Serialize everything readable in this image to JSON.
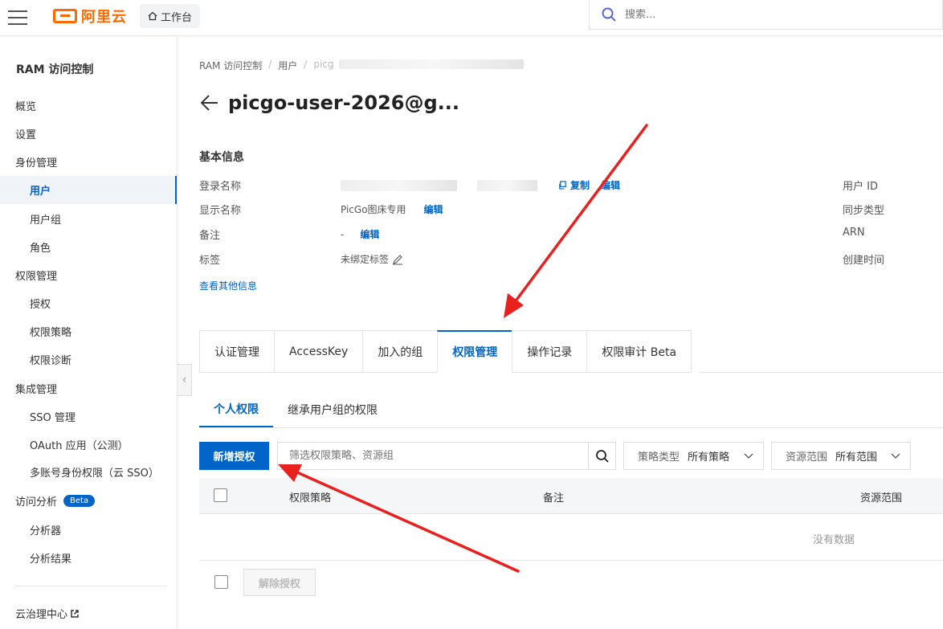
{
  "header": {
    "brand": "阿里云",
    "workbench": "工作台",
    "search_placeholder": "搜索..."
  },
  "sidebar": {
    "title": "RAM 访问控制",
    "items": [
      {
        "label": "概览",
        "level": 1
      },
      {
        "label": "设置",
        "level": 1
      },
      {
        "label": "身份管理",
        "level": 1
      },
      {
        "label": "用户",
        "level": 2,
        "active": true
      },
      {
        "label": "用户组",
        "level": 2
      },
      {
        "label": "角色",
        "level": 2
      },
      {
        "label": "权限管理",
        "level": 1
      },
      {
        "label": "授权",
        "level": 2
      },
      {
        "label": "权限策略",
        "level": 2
      },
      {
        "label": "权限诊断",
        "level": 2
      },
      {
        "label": "集成管理",
        "level": 1
      },
      {
        "label": "SSO 管理",
        "level": 2
      },
      {
        "label": "OAuth 应用（公测）",
        "level": 2
      },
      {
        "label": "多账号身份权限（云 SSO）",
        "level": 2
      },
      {
        "label": "访问分析",
        "level": 1,
        "badge": "Beta"
      },
      {
        "label": "分析器",
        "level": 2
      },
      {
        "label": "分析结果",
        "level": 2
      }
    ],
    "footer": "云治理中心"
  },
  "breadcrumb": [
    "RAM 访问控制",
    "用户",
    "picg"
  ],
  "page": {
    "title": "picgo-user-2026@g..."
  },
  "basic_info": {
    "title": "基本信息",
    "rows": [
      {
        "label": "登录名称",
        "value": "",
        "actions": [
          "复制",
          "编辑"
        ]
      },
      {
        "label": "显示名称",
        "value": "PicGo图床专用",
        "actions": [
          "编辑"
        ]
      },
      {
        "label": "备注",
        "value": "-",
        "actions": [
          "编辑"
        ]
      },
      {
        "label": "标签",
        "value": "未绑定标签",
        "actions": []
      }
    ],
    "right_labels": [
      "用户 ID",
      "同步类型",
      "ARN",
      "创建时间"
    ],
    "more_link": "查看其他信息"
  },
  "tabs": [
    {
      "label": "认证管理"
    },
    {
      "label": "AccessKey"
    },
    {
      "label": "加入的组"
    },
    {
      "label": "权限管理",
      "active": true
    },
    {
      "label": "操作记录"
    },
    {
      "label": "权限审计 Beta"
    }
  ],
  "subtabs": [
    {
      "label": "个人权限",
      "active": true
    },
    {
      "label": "继承用户组的权限"
    }
  ],
  "toolbar": {
    "add_button": "新增授权",
    "filter_placeholder": "筛选权限策略、资源组",
    "policy_type_label": "策略类型",
    "policy_type_value": "所有策略",
    "scope_label": "资源范围",
    "scope_value": "所有范围"
  },
  "table": {
    "columns": [
      "权限策略",
      "备注",
      "资源范围"
    ],
    "empty_text": "没有数据",
    "remove_button": "解除授权"
  },
  "colors": {
    "brand": "#ff6a00",
    "primary": "#0064c8",
    "annotation": "#e8201e"
  }
}
